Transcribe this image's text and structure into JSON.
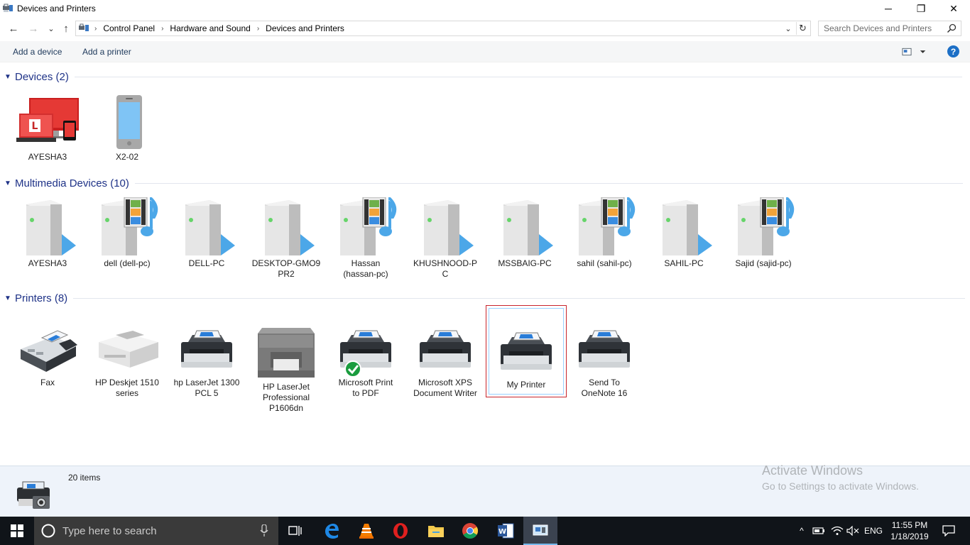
{
  "window": {
    "title": "Devices and Printers",
    "minimize_glyph": "─",
    "restore_glyph": "❐",
    "close_glyph": "✕"
  },
  "nav": {
    "back_glyph": "←",
    "forward_glyph": "→",
    "recent_glyph": "⌄",
    "up_glyph": "↑"
  },
  "address": {
    "crumbs": [
      "Control Panel",
      "Hardware and Sound",
      "Devices and Printers"
    ],
    "separator": "›",
    "dropdown_glyph": "⌄",
    "refresh_glyph": "↻"
  },
  "search": {
    "placeholder": "Search Devices and Printers"
  },
  "commands": {
    "add_device": "Add a device",
    "add_printer": "Add a printer",
    "help": "?"
  },
  "groups": {
    "devices": {
      "title": "Devices (2)",
      "items": [
        "AYESHA3",
        "X2-02"
      ]
    },
    "multimedia": {
      "title": "Multimedia Devices (10)",
      "items": [
        "AYESHA3",
        "dell (dell-pc)",
        "DELL-PC",
        "DESKTOP-GMO9\nPR2",
        "Hassan\n(hassan-pc)",
        "KHUSHNOOD-P\nC",
        "MSSBAIG-PC",
        "sahil (sahil-pc)",
        "SAHIL-PC",
        "Sajid (sajid-pc)"
      ]
    },
    "printers": {
      "title": "Printers (8)",
      "items": [
        "Fax",
        "HP Deskjet 1510\nseries",
        "hp LaserJet 1300\nPCL 5",
        "HP LaserJet\nProfessional\nP1606dn",
        "Microsoft Print\nto PDF",
        "Microsoft XPS\nDocument Writer",
        "My Printer",
        "Send To\nOneNote 16"
      ]
    }
  },
  "details": {
    "count": "20 items"
  },
  "watermark": {
    "line1": "Activate Windows",
    "line2": "Go to Settings to activate Windows."
  },
  "taskbar": {
    "search_placeholder": "Type here to search",
    "language": "ENG",
    "time": "11:55 PM",
    "date": "1/18/2019",
    "tray_chevron": "^"
  },
  "colors": {
    "accent": "#1e3287",
    "selection_border": "#c8242c",
    "taskbar": "#101419"
  }
}
